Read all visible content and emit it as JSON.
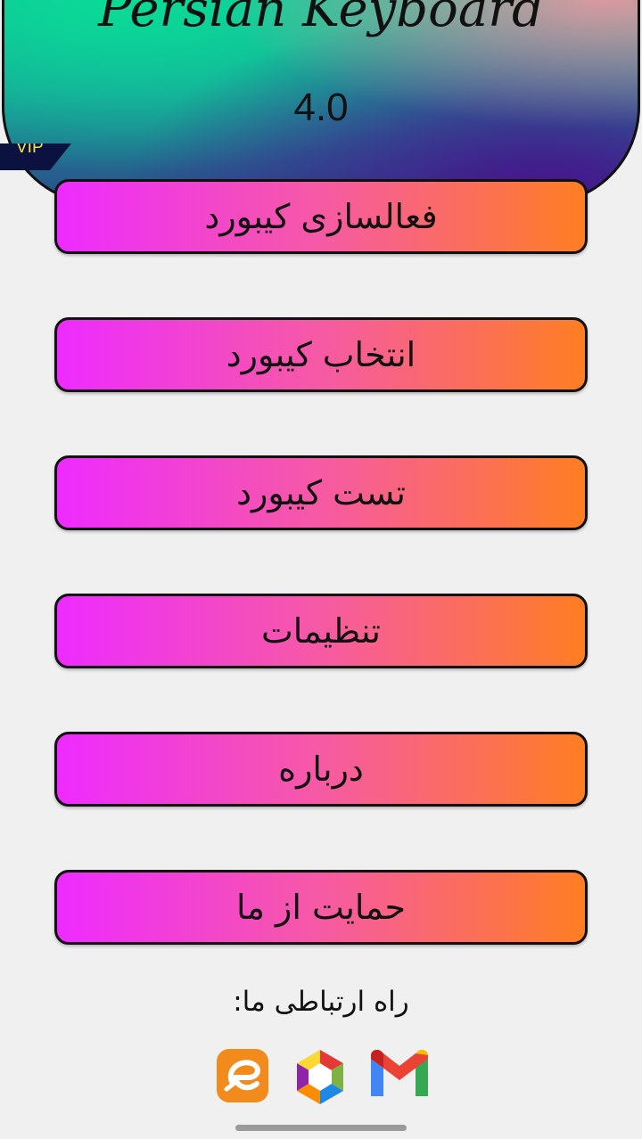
{
  "header": {
    "title": "Persian Keyboard",
    "version": "4.0",
    "vip_badge": "VIP"
  },
  "menu": [
    {
      "label": "فعالسازی کیبورد"
    },
    {
      "label": "انتخاب کیبورد"
    },
    {
      "label": "تست کیبورد"
    },
    {
      "label": "تنظیمات"
    },
    {
      "label": "درباره"
    },
    {
      "label": "حمایت از ما"
    }
  ],
  "contact": {
    "label": "راه ارتباطی ما:",
    "icons": [
      "eitaa-icon",
      "rubika-icon",
      "gmail-icon"
    ]
  },
  "colors": {
    "button_gradient_start": "#ee2bff",
    "button_gradient_end": "#ff7e22",
    "background": "#f0f0f0",
    "vip_badge_bg": "#0c1240",
    "vip_badge_text": "#f3e14a"
  }
}
